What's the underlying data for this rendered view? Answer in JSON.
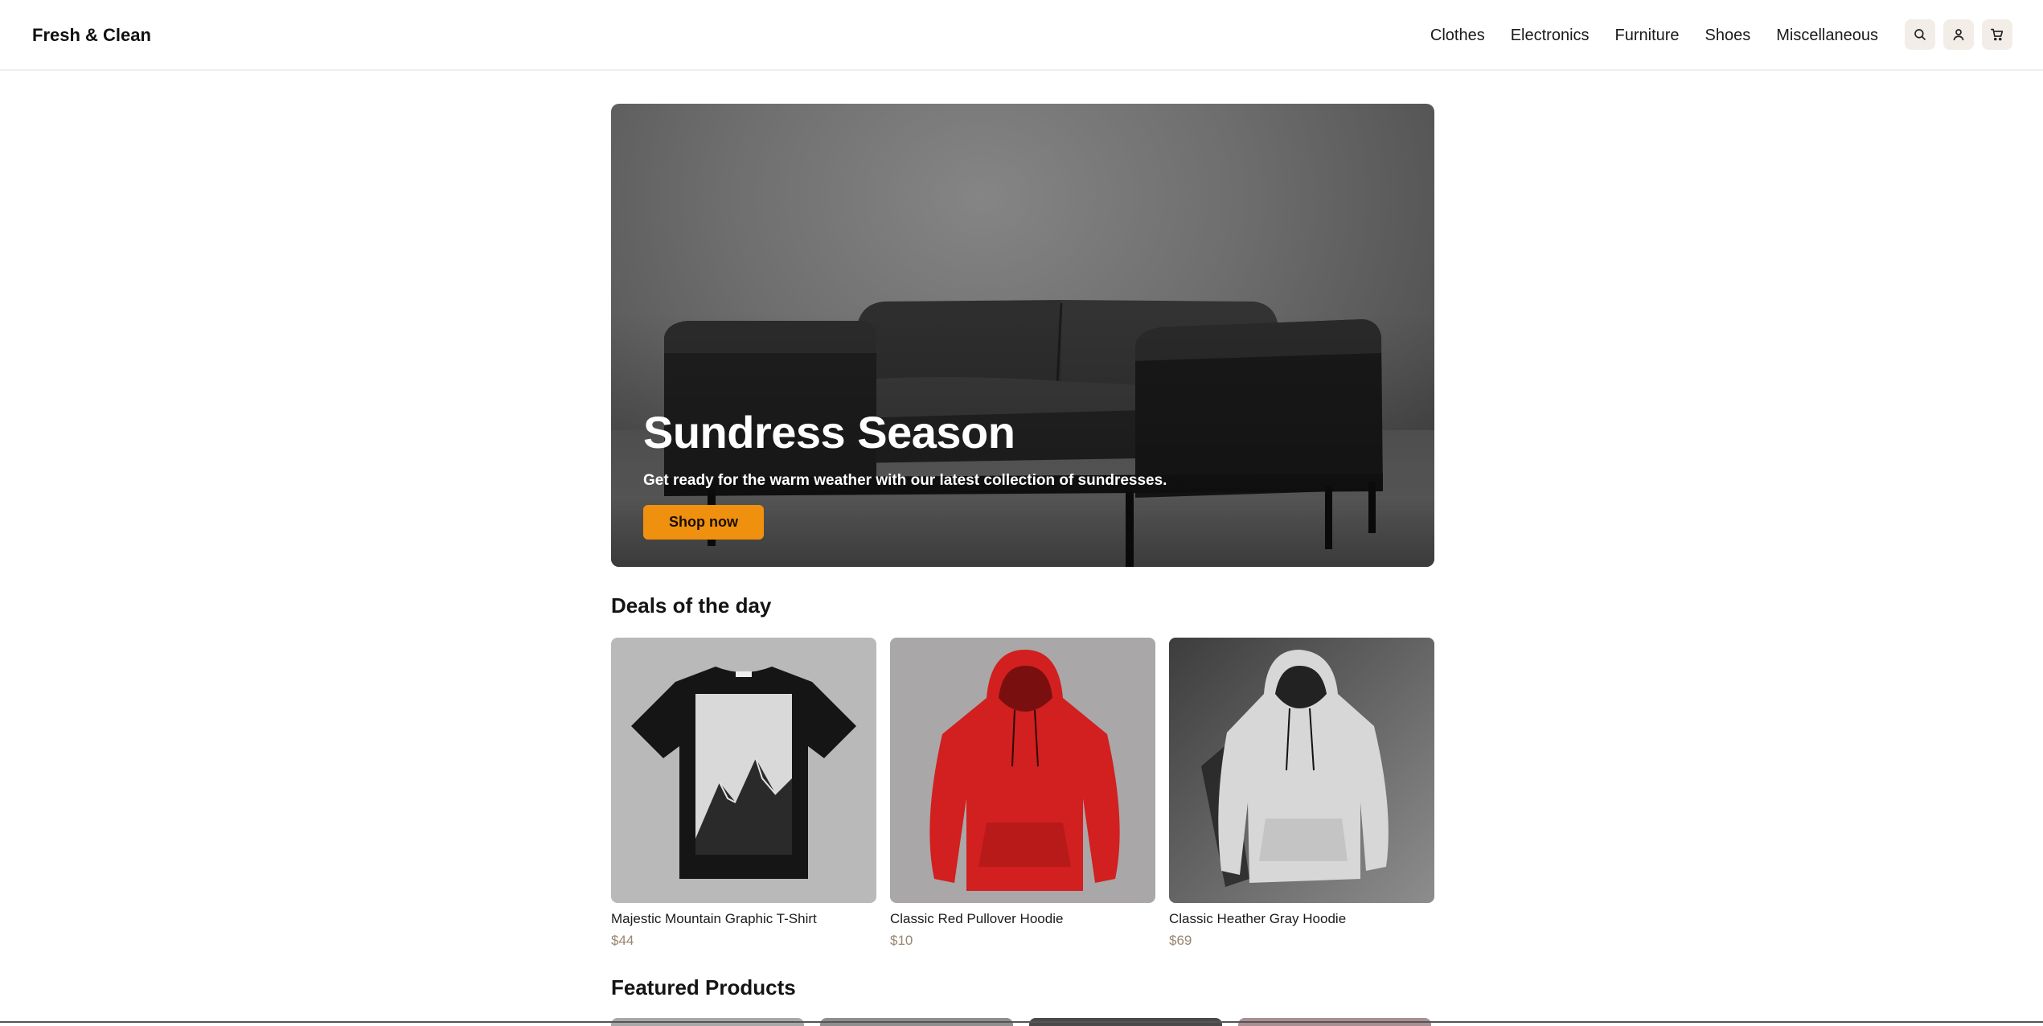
{
  "header": {
    "brand": "Fresh & Clean",
    "nav": [
      "Clothes",
      "Electronics",
      "Furniture",
      "Shoes",
      "Miscellaneous"
    ],
    "icons": [
      "search-icon",
      "user-icon",
      "cart-icon"
    ]
  },
  "hero": {
    "title": "Sundress Season",
    "subtitle": "Get ready for the warm weather with our latest collection of sundresses.",
    "cta": "Shop now"
  },
  "deals": {
    "title": "Deals of the day",
    "products": [
      {
        "name": "Majestic Mountain Graphic T-Shirt",
        "price": "$44"
      },
      {
        "name": "Classic Red Pullover Hoodie",
        "price": "$10"
      },
      {
        "name": "Classic Heather Gray Hoodie",
        "price": "$69"
      }
    ]
  },
  "featured": {
    "title": "Featured Products"
  },
  "colors": {
    "accent": "#f0900f",
    "price": "#9a8670",
    "icon_bg": "#f3ede8"
  }
}
